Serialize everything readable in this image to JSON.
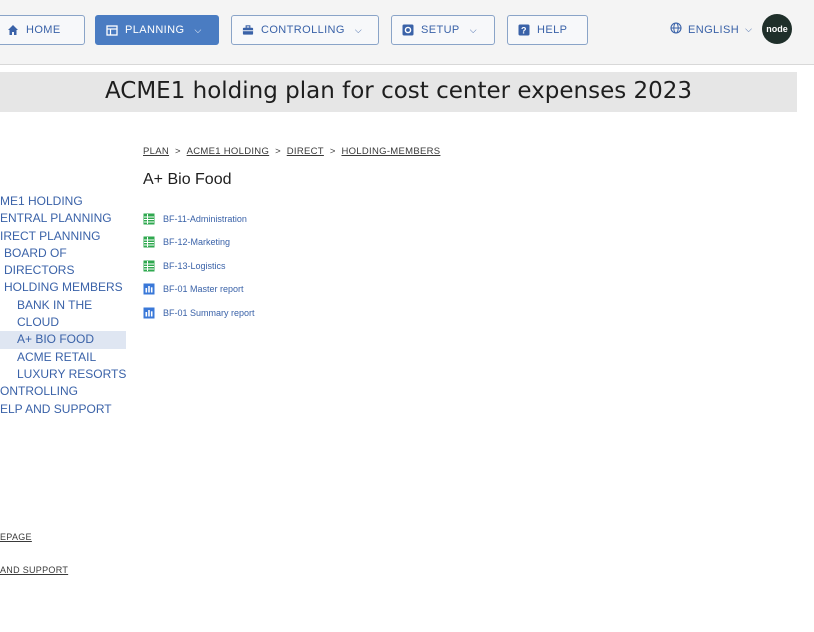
{
  "nav": {
    "home": "HOME",
    "planning": "PLANNING",
    "controlling": "CONTROLLING",
    "setup": "SETUP",
    "help": "HELP",
    "language": "ENGLISH",
    "logo_text": "node"
  },
  "title": "ACME1 holding plan for cost center expenses 2023",
  "tree": [
    {
      "label": "ME1 HOLDING",
      "level": 1
    },
    {
      "label": "ENTRAL PLANNING",
      "level": 1
    },
    {
      "label": "IRECT PLANNING",
      "level": 1
    },
    {
      "label": "BOARD OF",
      "level": 2
    },
    {
      "label": "DIRECTORS",
      "level": 2
    },
    {
      "label": "HOLDING MEMBERS",
      "level": 2
    },
    {
      "label": "BANK IN THE",
      "level": 3
    },
    {
      "label": "CLOUD",
      "level": 3
    },
    {
      "label": "A+ BIO FOOD",
      "level": 3,
      "selected": true
    },
    {
      "label": "ACME RETAIL",
      "level": 3
    },
    {
      "label": "LUXURY RESORTS",
      "level": 3
    },
    {
      "label": "ONTROLLING",
      "level": 1
    },
    {
      "label": "ELP AND SUPPORT",
      "level": 1
    }
  ],
  "breadcrumb": {
    "items": [
      "PLAN",
      "ACME1 HOLDING",
      "DIRECT",
      "HOLDING-MEMBERS"
    ],
    "separator": ">"
  },
  "heading": "A+ Bio Food",
  "documents": [
    {
      "label": "BF-11-Administration",
      "icon": "sheet-icon"
    },
    {
      "label": "BF-12-Marketing",
      "icon": "sheet-icon"
    },
    {
      "label": "BF-13-Logistics",
      "icon": "sheet-icon"
    },
    {
      "label": "BF-01 Master report",
      "icon": "report-icon"
    },
    {
      "label": "BF-01 Summary report",
      "icon": "report-icon"
    }
  ],
  "footer": {
    "homepage": "EPAGE",
    "support": "AND SUPPORT"
  },
  "colors": {
    "accent": "#4a7cc2",
    "link": "#3a62a8",
    "sheet": "#2fa84f",
    "report": "#3a78d8"
  }
}
